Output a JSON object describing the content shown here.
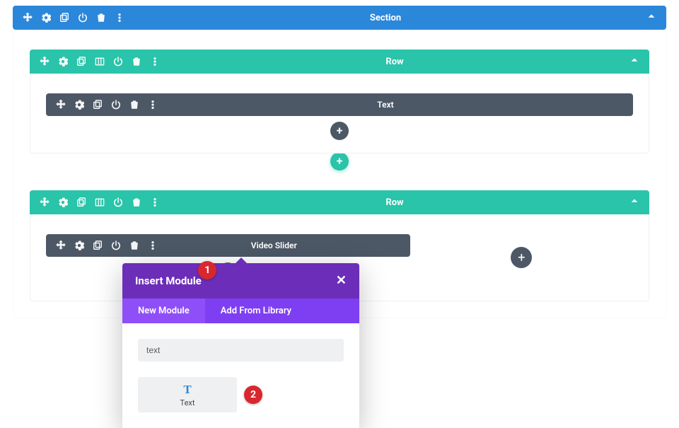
{
  "section": {
    "title": "Section"
  },
  "rows": [
    {
      "title": "Row",
      "modules": [
        {
          "title": "Text"
        }
      ]
    },
    {
      "title": "Row",
      "modules": [
        {
          "title": "Video Slider"
        }
      ]
    }
  ],
  "annotations": {
    "one": "1",
    "two": "2"
  },
  "modal": {
    "title": "Insert Module",
    "tabs": {
      "new": "New Module",
      "library": "Add From Library"
    },
    "search_value": "text",
    "module_tile": {
      "icon_glyph": "T",
      "label": "Text"
    }
  },
  "glyphs": {
    "plus": "+",
    "close": "✕"
  }
}
